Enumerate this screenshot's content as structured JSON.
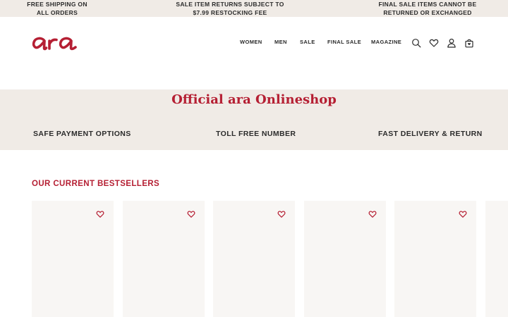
{
  "promo": {
    "items": [
      "FREE SHIPPING ON\nALL ORDERS",
      "SALE ITEM RETURNS SUBJECT TO\n$7.99 RESTOCKING FEE",
      "FINAL SALE ITEMS CANNOT BE\nRETURNED OR EXCHANGED"
    ]
  },
  "header": {
    "logo_text": "ara",
    "nav": [
      "WOMEN",
      "MEN",
      "SALE",
      "FINAL SALE",
      "MAGAZINE"
    ],
    "icons": [
      "search-icon",
      "heart-icon",
      "account-icon",
      "bag-icon"
    ]
  },
  "usp": {
    "title": "Official ara Onlineshop",
    "items": [
      "SAFE PAYMENT OPTIONS",
      "TOLL FREE NUMBER",
      "FAST DELIVERY & RETURN"
    ]
  },
  "bestsellers": {
    "title": "OUR CURRENT BESTSELLERS",
    "product_count": 6
  },
  "colors": {
    "brand": "#b51f33",
    "beige": "#f0ebe6",
    "card": "#f8f6f4",
    "text": "#2b2b2b"
  }
}
